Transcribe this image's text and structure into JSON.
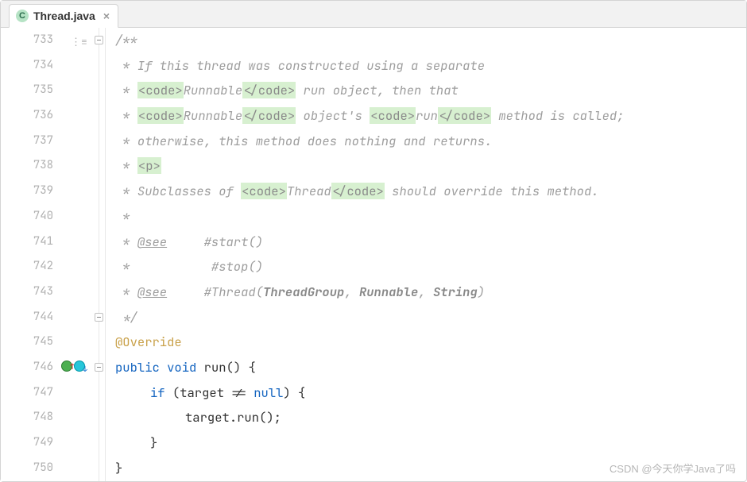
{
  "tab": {
    "icon_letter": "C",
    "filename": "Thread.java"
  },
  "gutter": {
    "start": 733,
    "end": 750
  },
  "code": {
    "l733": "/**",
    "l734_pre": " * ",
    "l734_text": "If this thread was constructed using a separate",
    "l735_pre": " * ",
    "l735_t1": "<code>",
    "l735_t2": "Runnable",
    "l735_t3": "</code>",
    "l735_rest": " run object, then that",
    "l736_pre": " * ",
    "l736_t1": "<code>",
    "l736_t2": "Runnable",
    "l736_t3": "</code>",
    "l736_mid": " object's ",
    "l736_t4": "<code>",
    "l736_t5": "run",
    "l736_t6": "</code>",
    "l736_rest": " method is called;",
    "l737_pre": " * ",
    "l737_text": "otherwise, this method does nothing and returns.",
    "l738_pre": " * ",
    "l738_tag": "<p>",
    "l739_pre": " * ",
    "l739_a": "Subclasses of ",
    "l739_t1": "<code>",
    "l739_t2": "Thread",
    "l739_t3": "</code>",
    "l739_b": " should override this method.",
    "l740": " *",
    "l741_pre": " * ",
    "l741_see": "@see",
    "l741_ref": "     #start()",
    "l742_pre": " *           ",
    "l742_ref": "#stop()",
    "l743_pre": " * ",
    "l743_see": "@see",
    "l743_sp": "     ",
    "l743_m": "#Thread(",
    "l743_a1": "ThreadGroup",
    "l743_c1": ", ",
    "l743_a2": "Runnable",
    "l743_c2": ", ",
    "l743_a3": "String",
    "l743_close": ")",
    "l744": " */",
    "l745": "@Override",
    "l746_kw1": "public",
    "l746_kw2": "void",
    "l746_name": "run",
    "l746_rest": "() {",
    "l747_kw": "if",
    "l747_cond": " (target != ",
    "l747_null": "null",
    "l747_rest": ") {",
    "l748_a": "target",
    "l748_b": ".run();",
    "l749": "}",
    "l750": "}"
  },
  "watermark": "CSDN @今天你学Java了吗"
}
